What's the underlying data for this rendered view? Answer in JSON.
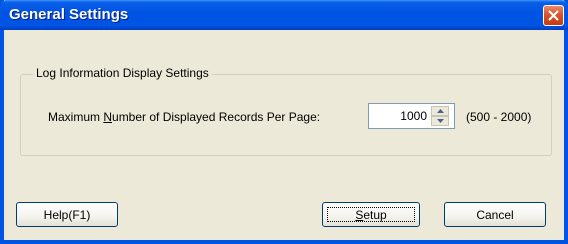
{
  "window": {
    "title": "General Settings"
  },
  "group": {
    "label": "Log Information Display Settings",
    "field_prefix": "Maximum ",
    "field_accel": "N",
    "field_suffix": "umber of Displayed Records Per Page:",
    "value": "1000",
    "range": "(500 - 2000)"
  },
  "buttons": {
    "help": "Help(F1)",
    "setup_accel": "S",
    "setup_rest": "etup",
    "cancel": "Cancel"
  },
  "colors": {
    "titlebar": "#0054e3",
    "close": "#d9552c",
    "dialog_bg": "#ece9d8"
  },
  "icons": {
    "close": "close-icon",
    "spin_up": "chevron-up-icon",
    "spin_down": "chevron-down-icon"
  }
}
